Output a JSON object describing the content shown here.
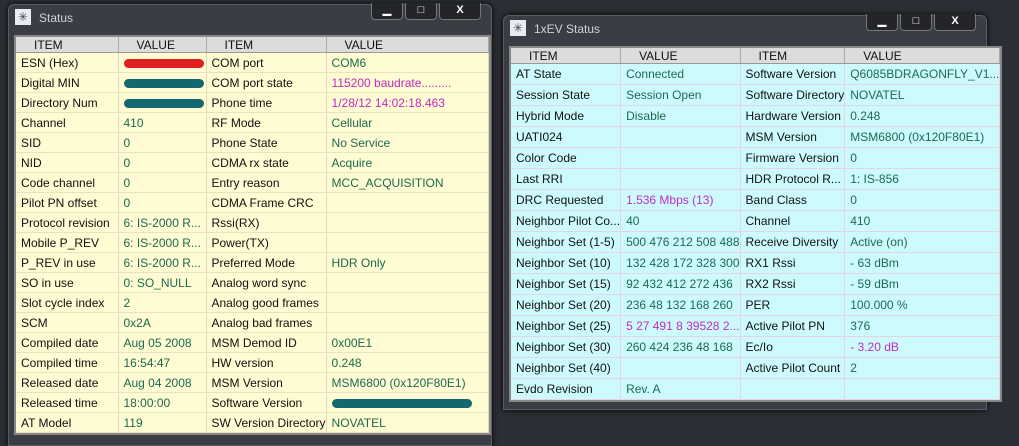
{
  "status_window": {
    "title": "Status",
    "minimize": "▁",
    "maximize": "□",
    "close": "X",
    "headers": [
      "ITEM",
      "VALUE",
      "ITEM",
      "VALUE"
    ],
    "rows": [
      {
        "item1": "ESN (Hex)",
        "value1": "",
        "redact1": "#e02020",
        "item2": "COM port",
        "value2": "COM6"
      },
      {
        "item1": "Digital MIN",
        "value1": "",
        "redact1": "#13676f",
        "item2": "COM port state",
        "value2": "115200 baudrate.........",
        "mag2": true
      },
      {
        "item1": "Directory Num",
        "value1": "",
        "redact1": "#13676f",
        "item2": "Phone time",
        "value2": "1/28/12 14:02:18.463",
        "mag2": true
      },
      {
        "item1": "Channel",
        "value1": "410",
        "item2": "RF Mode",
        "value2": "Cellular"
      },
      {
        "item1": "SID",
        "value1": "0",
        "item2": "Phone State",
        "value2": "No Service"
      },
      {
        "item1": "NID",
        "value1": "0",
        "item2": "CDMA rx state",
        "value2": "Acquire"
      },
      {
        "item1": "Code channel",
        "value1": "0",
        "item2": "Entry reason",
        "value2": "MCC_ACQUISITION"
      },
      {
        "item1": "Pilot PN offset",
        "value1": "0",
        "item2": "CDMA Frame CRC",
        "value2": ""
      },
      {
        "item1": "Protocol revision",
        "value1": "6:  IS-2000 R...",
        "item2": "Rssi(RX)",
        "value2": ""
      },
      {
        "item1": "Mobile P_REV",
        "value1": "6:  IS-2000 R...",
        "item2": "Power(TX)",
        "value2": ""
      },
      {
        "item1": "P_REV in use",
        "value1": "6:  IS-2000 R...",
        "item2": "Preferred Mode",
        "value2": "HDR Only"
      },
      {
        "item1": "SO in use",
        "value1": "0: SO_NULL",
        "item2": "Analog word sync",
        "value2": ""
      },
      {
        "item1": "Slot cycle index",
        "value1": "2",
        "item2": "Analog good frames",
        "value2": ""
      },
      {
        "item1": "SCM",
        "value1": "0x2A",
        "item2": "Analog bad frames",
        "value2": ""
      },
      {
        "item1": "Compiled date",
        "value1": "Aug 05 2008",
        "item2": "MSM Demod ID",
        "value2": "0x00E1"
      },
      {
        "item1": "Compiled time",
        "value1": "16:54:47",
        "item2": "HW version",
        "value2": "0.248"
      },
      {
        "item1": "Released date",
        "value1": "Aug 04 2008",
        "item2": "MSM Version",
        "value2": "MSM6800 (0x120F80E1)"
      },
      {
        "item1": "Released time",
        "value1": "18:00:00",
        "item2": "Software Version",
        "value2": "",
        "redact2": "#13676f"
      },
      {
        "item1": "AT Model",
        "value1": "119",
        "item2": "SW Version Directory",
        "value2": "NOVATEL"
      }
    ]
  },
  "ev_window": {
    "title": "1xEV Status",
    "minimize": "▁",
    "maximize": "□",
    "close": "X",
    "headers": [
      "ITEM",
      "VALUE",
      "ITEM",
      "VALUE"
    ],
    "rows": [
      {
        "item1": "AT State",
        "value1": "Connected",
        "item2": "Software Version",
        "value2": "Q6085BDRAGONFLY_V1..."
      },
      {
        "item1": "Session State",
        "value1": "Session Open",
        "item2": "Software Directory",
        "value2": "NOVATEL"
      },
      {
        "item1": "Hybrid Mode",
        "value1": "Disable",
        "item2": "Hardware Version",
        "value2": "0.248"
      },
      {
        "item1": "UATI024",
        "value1": "",
        "item2": "MSM Version",
        "value2": "MSM6800 (0x120F80E1)"
      },
      {
        "item1": "Color Code",
        "value1": "",
        "item2": "Firmware Version",
        "value2": "0"
      },
      {
        "item1": "Last RRI",
        "value1": "",
        "item2": "HDR Protocol R...",
        "value2": "1: IS-856"
      },
      {
        "item1": "DRC Requested",
        "value1": "1.536 Mbps (13)",
        "mag1": true,
        "item2": "Band Class",
        "value2": "0"
      },
      {
        "item1": "Neighbor Pilot Co...",
        "value1": "40",
        "item2": "Channel",
        "value2": "410"
      },
      {
        "item1": "Neighbor Set (1-5)",
        "value1": "500 476 212 508 488",
        "item2": "Receive Diversity",
        "value2": "Active (on)"
      },
      {
        "item1": "Neighbor Set (10)",
        "value1": "132 428 172 328 300",
        "item2": "RX1 Rssi",
        "value2": "- 63 dBm"
      },
      {
        "item1": "Neighbor Set (15)",
        "value1": "92 432 412 272 436",
        "item2": "RX2 Rssi",
        "value2": "- 59 dBm"
      },
      {
        "item1": "Neighbor Set (20)",
        "value1": "236 48 132 168 260",
        "item2": "PER",
        "value2": "100.000 %"
      },
      {
        "item1": "Neighbor Set (25)",
        "value1": "5 27 491 8 39528 2...",
        "mag1": true,
        "item2": "Active Pilot PN",
        "value2": "376"
      },
      {
        "item1": "Neighbor Set (30)",
        "value1": "260 424 236 48 168",
        "item2": "Ec/Io",
        "value2": "- 3.20 dB",
        "mag2": true
      },
      {
        "item1": "Neighbor Set (40)",
        "value1": "",
        "item2": "Active Pilot Count",
        "value2": "2"
      },
      {
        "item1": "Evdo Revision",
        "value1": "Rev. A",
        "item2": "",
        "value2": ""
      }
    ]
  }
}
